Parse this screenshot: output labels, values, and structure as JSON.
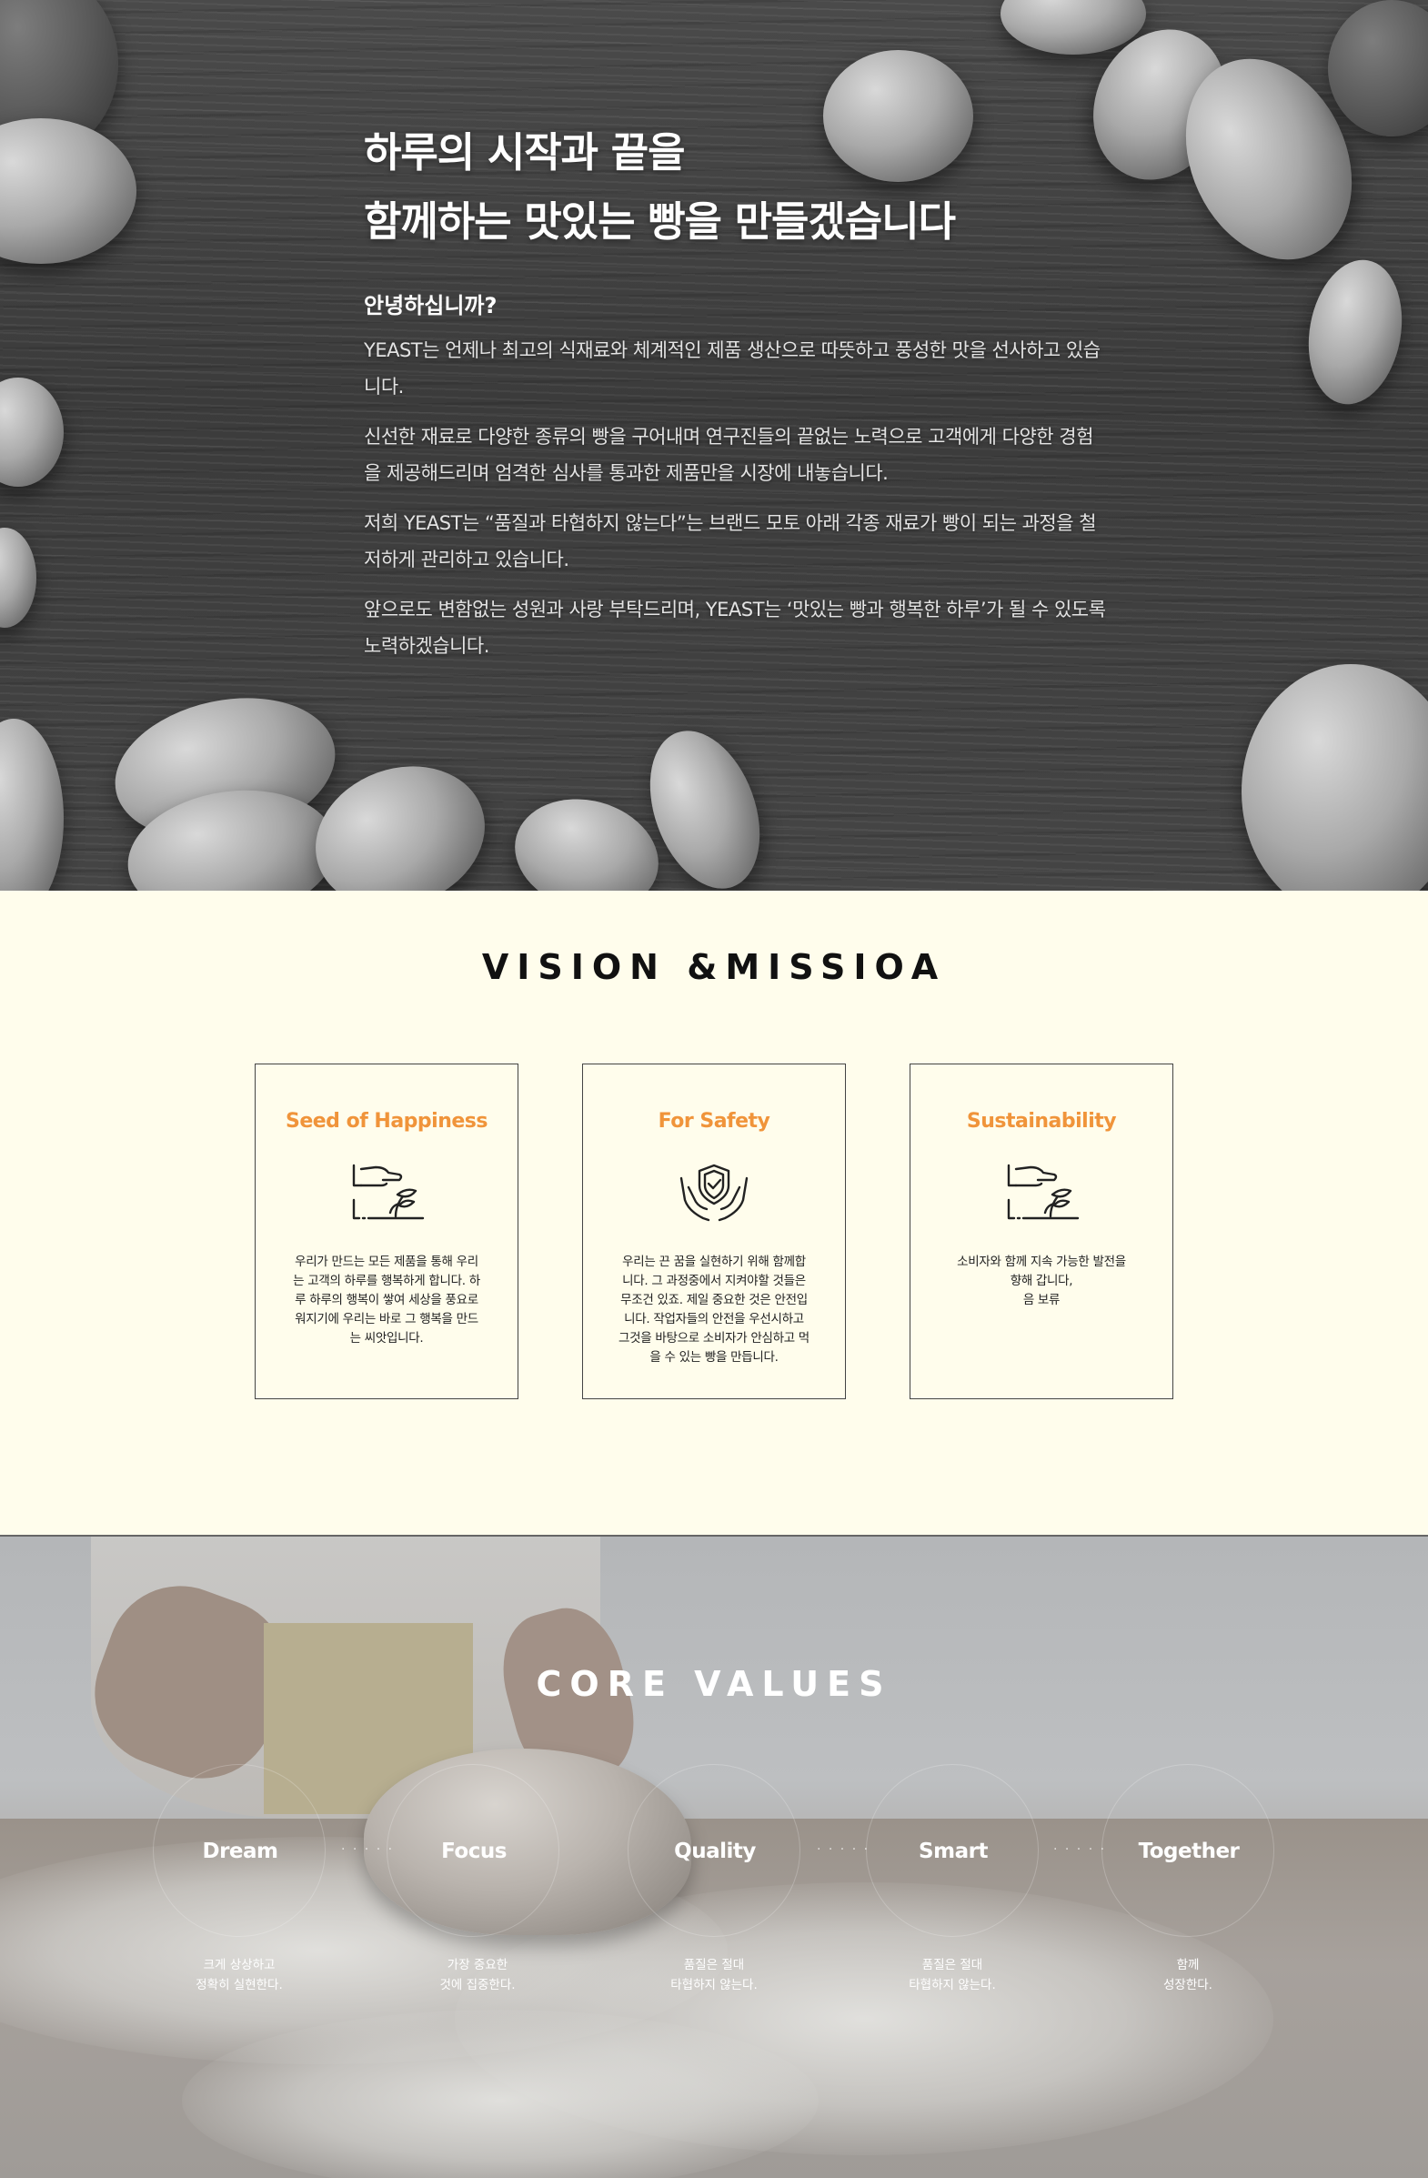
{
  "hero": {
    "title_line1": "하루의 시작과 끝을",
    "title_line2": "함께하는 맛있는 빵을 만들겠습니다",
    "greeting": "안녕하십니까?",
    "paragraphs": [
      "YEAST는 언제나 최고의 식재료와 체계적인 제품 생산으로 따뜻하고 풍성한 맛을 선사하고 있습니다.",
      "신선한 재료로 다양한 종류의 빵을 구어내며 연구진들의 끝없는 노력으로 고객에게 다양한 경험을 제공해드리며 엄격한 심사를 통과한 제품만을 시장에 내놓습니다.",
      "저희 YEAST는 “품질과 타협하지 않는다”는 브랜드 모토 아래 각종 재료가 빵이 되는 과정을 철저하게 관리하고 있습니다.",
      "앞으로도 변함없는 성원과 사랑 부탁드리며, YEAST는 ‘맛있는 빵과 행복한 하루’가 될 수 있도록 노력하겠습니다."
    ]
  },
  "vision": {
    "title": "VISION &MISSIOA",
    "accent_color": "#f0943a",
    "cards": [
      {
        "title": "Seed of Happiness",
        "icon": "hand-sprout-icon",
        "desc": "우리가 만드는 모든 제품을 통해 우리는 고객의 하루를 행복하게 합니다. 하루 하루의 행복이 쌓여 세상을 풍요로워지기에 우리는 바로 그 행복을 만드는 씨앗입니다."
      },
      {
        "title": "For Safety",
        "icon": "hands-shield-icon",
        "desc": "우리는 끈 꿈을 실현하기 위해 함께합니다. 그 과정중에서 지켜야할 것들은 무조건 있죠. 제일 중요한 것은 안전입니다. 작업자들의 안전을 우선시하고 그것을 바탕으로 소비자가 안심하고 먹을 수 있는 빵을 만듭니다."
      },
      {
        "title": "Sustainability",
        "icon": "hand-sprout-icon",
        "desc_lines": [
          "소비자와 함께 지속 가능한 발전을",
          "향해 갑니다,",
          "음 보류"
        ]
      }
    ]
  },
  "core": {
    "title": "CORE VALUES",
    "values": [
      {
        "name": "Dream",
        "desc_lines": [
          "크게 상상하고",
          "정확히 실현한다."
        ]
      },
      {
        "name": "Focus",
        "desc_lines": [
          "가장 중요한",
          "것에 집중한다."
        ]
      },
      {
        "name": "Quality",
        "desc_lines": [
          "품질은 절대",
          "타협하지 않는다."
        ]
      },
      {
        "name": "Smart",
        "desc_lines": [
          "품질은 절대",
          "타협하지 않는다."
        ]
      },
      {
        "name": "Together",
        "desc_lines": [
          "함께",
          "성장한다."
        ]
      }
    ],
    "separator": "· · · · ·"
  }
}
